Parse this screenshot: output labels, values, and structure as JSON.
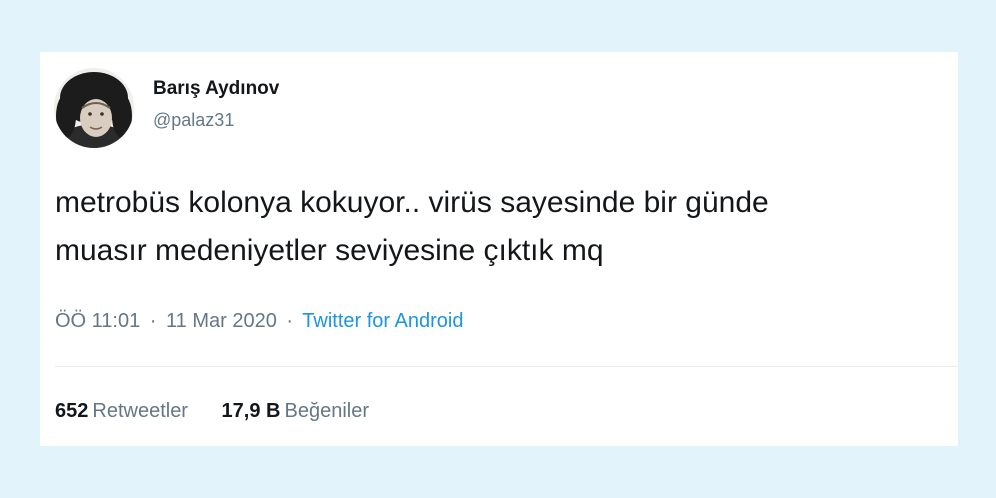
{
  "tweet": {
    "author": {
      "name": "Barış Aydınov",
      "handle": "@palaz31",
      "avatar_icon": "user-avatar-photo"
    },
    "text_lines": [
      "metrobüs kolonya kokuyor.. virüs sayesinde bir günde",
      "muasır medeniyetler seviyesine çıktık mq"
    ],
    "time": "ÖÖ 11:01",
    "separator": "·",
    "date": "11 Mar 2020",
    "source": "Twitter for Android",
    "stats": {
      "retweets_count": "652",
      "retweets_label": "Retweetler",
      "likes_count": "17,9 B",
      "likes_label": "Beğeniler"
    }
  },
  "colors": {
    "page_background": "#e3f3fb",
    "card_background": "#ffffff",
    "primary_text": "#14171a",
    "secondary_text": "#657786",
    "link": "#1b95e0"
  }
}
